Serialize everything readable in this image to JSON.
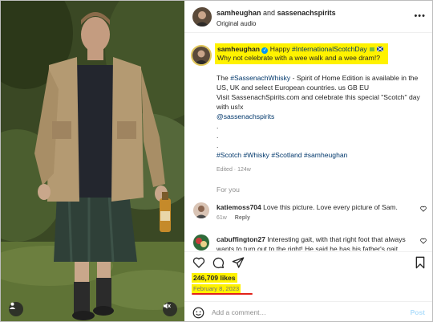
{
  "header": {
    "author": "samheughan",
    "joiner": "and",
    "collaborator": "sassenachspirits",
    "audio": "Original audio",
    "more_icon": "more-horizontal-icon"
  },
  "caption": {
    "username": "samheughan",
    "line1_prefix": "Happy",
    "line1_hashtag": "#InternationalScotchDay",
    "line2": "Why not celebrate with a wee walk and a wee dram!?",
    "body_1_pre": "The",
    "body_1_tag": "#SassenachWhisky",
    "body_1_post": "- Spirit of Home Edition is available in the",
    "body_2": "US, UK and select European countries. us 🇬🇧 🇪🇺",
    "body_2_display": "US, UK and select European countries. us GB EU",
    "body_3": "Visit SassenachSpirits.com and celebrate this special \"Scotch\" day",
    "body_4": "with us!x",
    "mention": "@sassenachspirits",
    "dot": ".",
    "hashtags": [
      "#Scotch",
      "#Whisky",
      "#Scotland",
      "#samheughan"
    ],
    "edited": "Edited · 124w",
    "highlight_color": "#fff200"
  },
  "for_you": "For you",
  "comments": [
    {
      "username": "katiemoss704",
      "text": "Love this picture. Love every picture of Sam.",
      "age": "61w",
      "reply": "Reply"
    },
    {
      "username": "cabuffington27",
      "text": "Interesting gait, with that right foot that always wants to turn out to the right! He said he has his father's gait.",
      "age": "",
      "reply": ""
    }
  ],
  "actions": {
    "like_icon": "heart-icon",
    "comment_icon": "comment-icon",
    "share_icon": "share-icon",
    "save_icon": "bookmark-icon"
  },
  "likes": "246,709 likes",
  "date": "February 8, 2023",
  "add_comment": {
    "placeholder": "Add a comment…",
    "post_label": "Post",
    "emoji_icon": "smile-icon"
  },
  "colors": {
    "link": "#00376b",
    "verified": "#0095f6",
    "highlight": "#fff200",
    "underline": "#e2231a",
    "post_disabled": "#b2dffc"
  }
}
